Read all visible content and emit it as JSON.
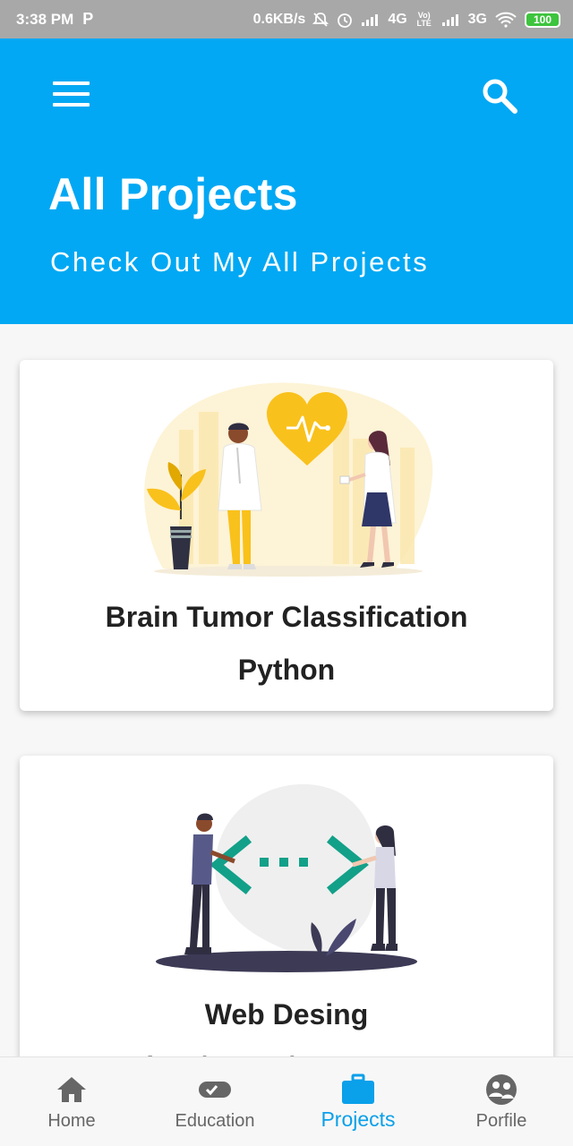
{
  "status_bar": {
    "time": "3:38 PM",
    "app_icon": "parking-p-icon",
    "net_speed": "0.6KB/s",
    "network_1": "4G",
    "volte": "Vo) LTE",
    "network_2": "3G",
    "battery": "100",
    "colors": {
      "background": "#a8a8a8",
      "battery": "#3ec43e"
    }
  },
  "header": {
    "title": "All Projects",
    "subtitle": "Check Out My All Projects",
    "menu_icon": "hamburger-menu-icon",
    "search_icon": "search-icon",
    "background_color": "#02a8f3"
  },
  "projects": [
    {
      "title_line_1": "Brain Tumor Classification",
      "title_line_2": "Python",
      "image": "doctors-heart-illustration"
    },
    {
      "title_line_1": "Web Desing",
      "title_line_2": "Python/HTML/JAVASCRIPT",
      "image": "web-code-illustration"
    }
  ],
  "bottom_nav": [
    {
      "label": "Home",
      "icon": "home-icon"
    },
    {
      "label": "Education",
      "icon": "toggle-icon"
    },
    {
      "label": "Projects",
      "icon": "briefcase-icon",
      "active": true
    },
    {
      "label": "Porfile",
      "icon": "profile-group-icon"
    }
  ],
  "colors": {
    "accent": "#0aa0ea",
    "inactive": "#666666",
    "illustration_yellow": "#f9c11b",
    "code_green": "#12a089"
  }
}
